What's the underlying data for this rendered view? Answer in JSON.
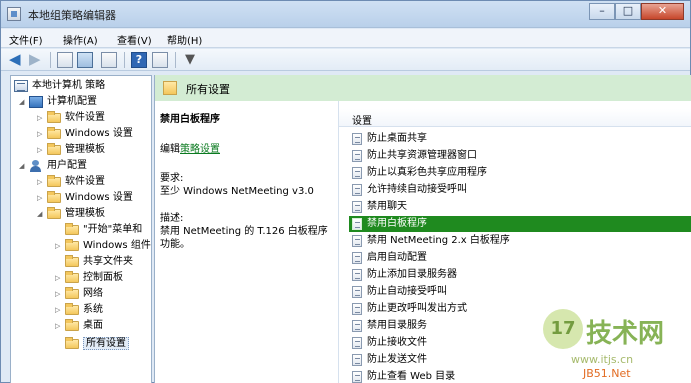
{
  "window": {
    "title": "本地组策略编辑器"
  },
  "menubar": {
    "items": [
      "文件(F)",
      "操作(A)",
      "查看(V)",
      "帮助(H)"
    ]
  },
  "toolbar": {
    "icons": [
      "back-arrow-icon",
      "forward-arrow-icon",
      "up-folder-icon",
      "show-tree-icon",
      "export-list-icon",
      "help-icon",
      "properties-icon",
      "filter-icon"
    ]
  },
  "tree": {
    "root": "本地计算机 策略",
    "computer": {
      "label": "计算机配置",
      "children": [
        "软件设置",
        "Windows 设置",
        "管理模板"
      ]
    },
    "user": {
      "label": "用户配置",
      "children": [
        "软件设置",
        "Windows 设置",
        "管理模板"
      ],
      "templates": [
        "\"开始\"菜单和",
        "Windows 组件",
        "共享文件夹",
        "控制面板",
        "网络",
        "系统",
        "桌面",
        "所有设置"
      ]
    }
  },
  "detail": {
    "header_title": "所有设置",
    "desc": {
      "title": "禁用白板程序",
      "edit_prefix": "编辑",
      "edit_link": "策略设置",
      "req_label": "要求:",
      "req_value": "至少 Windows NetMeeting v3.0",
      "desc_label": "描述:",
      "desc_line1": "禁用 NetMeeting 的 T.126 白板程序",
      "desc_line2": "功能。"
    },
    "list_header": "设置",
    "rows": [
      "防止桌面共享",
      "防止共享资源管理器窗口",
      "防止以真彩色共享应用程序",
      "允许持续自动接受呼叫",
      "禁用聊天",
      "禁用白板程序",
      "禁用 NetMeeting 2.x 白板程序",
      "启用自动配置",
      "防止添加目录服务器",
      "防止自动接受呼叫",
      "防止更改呼叫发出方式",
      "禁用目录服务",
      "防止接收文件",
      "防止发送文件",
      "防止查看 Web 目录"
    ],
    "selected_row": 5
  },
  "watermark": {
    "logo": "17",
    "cn": "技术网",
    "url": "www.itjs.cn",
    "jb": "JB51.Net"
  }
}
